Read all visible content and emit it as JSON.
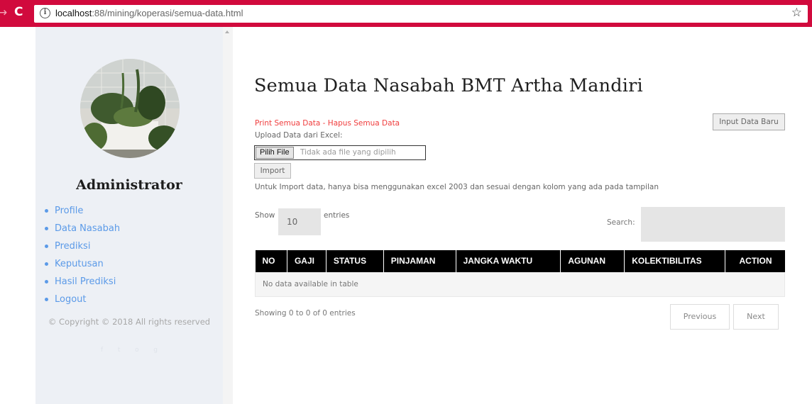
{
  "browser": {
    "url_host": "localhost",
    "url_rest": ":88/mining/koperasi/semua-data.html",
    "icons": [
      "back-icon",
      "reload-icon",
      "info-icon",
      "star-icon"
    ]
  },
  "sidebar": {
    "title": "Administrator",
    "items": [
      {
        "label": "Profile"
      },
      {
        "label": "Data Nasabah"
      },
      {
        "label": "Prediksi"
      },
      {
        "label": "Keputusan"
      },
      {
        "label": "Hasil Prediksi"
      },
      {
        "label": "Logout"
      }
    ],
    "copyright": "© Copyright © 2018 All rights reserved",
    "social_icons": [
      "facebook-icon",
      "twitter-icon",
      "instagram-icon",
      "github-icon"
    ]
  },
  "main": {
    "title": "Semua Data Nasabah BMT Artha Mandiri",
    "red_links": "Print Semua Data - Hapus Semua Data",
    "upload_label": "Upload Data dari Excel:",
    "file_button": "Pilih File",
    "file_status": "Tidak ada file yang dipilih",
    "import_button": "Import",
    "import_note": "Untuk Import data, hanya bisa menggunakan excel 2003 dan sesuai dengan kolom yang ada pada tampilan",
    "input_baru_button": "Input Data Baru"
  },
  "table": {
    "show_label": "Show",
    "entries_value": "10",
    "entries_label": "entries",
    "search_label": "Search:",
    "columns": [
      "NO",
      "GAJI",
      "STATUS",
      "PINJAMAN",
      "JANGKA WAKTU",
      "AGUNAN",
      "KOLEKTIBILITAS",
      "ACTION"
    ],
    "empty_message": "No data available in table",
    "info": "Showing 0 to 0 of 0 entries",
    "previous": "Previous",
    "next": "Next"
  },
  "colors": {
    "browser_bar": "#d10a3d",
    "sidebar_bg": "#edf0f5",
    "link_blue": "#5b9ae8",
    "link_red": "#f03d3d",
    "table_header": "#000000"
  }
}
